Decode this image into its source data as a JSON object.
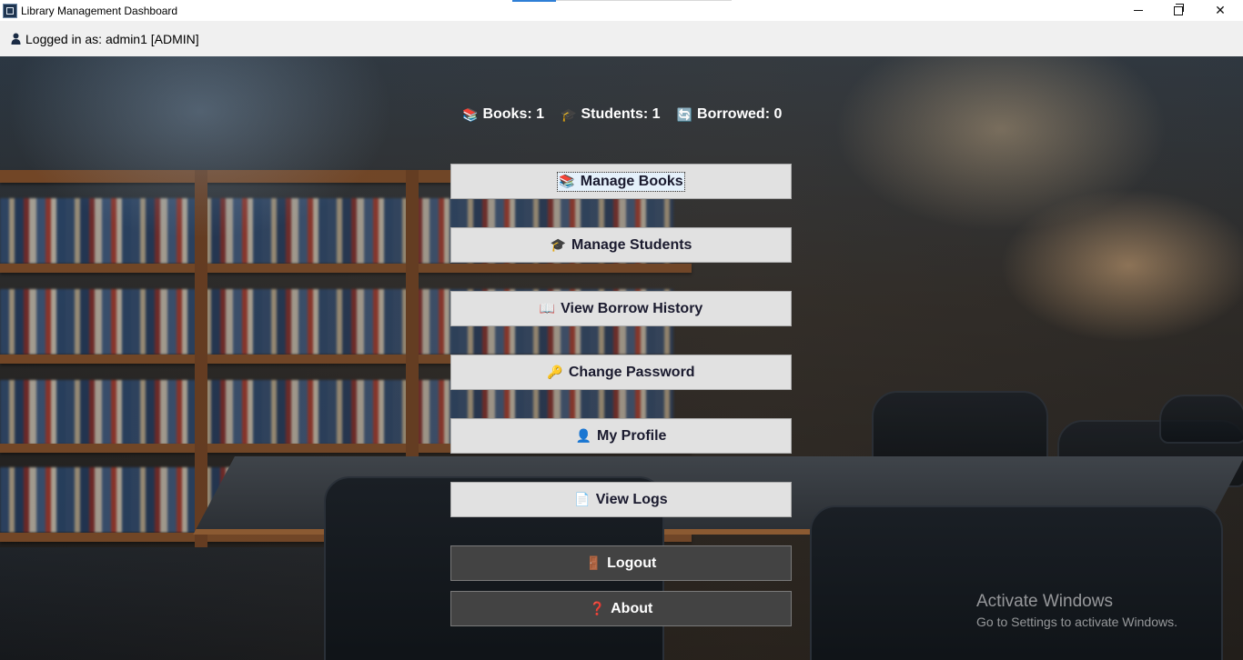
{
  "window": {
    "title": "Library Management Dashboard",
    "controls": {
      "minimize": "minimize",
      "maximize": "restore",
      "close": "✕"
    }
  },
  "status": {
    "user_icon": "user-icon",
    "text": "Logged in as: admin1 [ADMIN]"
  },
  "stats": [
    {
      "icon": "books-icon",
      "glyph": "📚",
      "label": "Books: 1"
    },
    {
      "icon": "graduation-cap-icon",
      "glyph": "🎓",
      "label": "Students: 1"
    },
    {
      "icon": "sync-icon",
      "glyph": "🔄",
      "label": "Borrowed: 0"
    }
  ],
  "menu": {
    "manage_books": {
      "icon": "books-icon",
      "glyph": "📚",
      "label": "Manage Books",
      "focused": true
    },
    "manage_students": {
      "icon": "graduation-cap-icon",
      "glyph": "🎓",
      "label": "Manage Students"
    },
    "view_borrow_history": {
      "icon": "open-book-icon",
      "glyph": "📖",
      "label": "View Borrow History"
    },
    "change_password": {
      "icon": "key-icon",
      "glyph": "🔑",
      "label": "Change Password"
    },
    "my_profile": {
      "icon": "user-icon",
      "glyph": "👤",
      "label": "My Profile"
    },
    "view_logs": {
      "icon": "document-icon",
      "glyph": "📄",
      "label": "View Logs"
    },
    "logout": {
      "icon": "door-icon",
      "glyph": "🚪",
      "label": "Logout"
    },
    "about": {
      "icon": "question-icon",
      "glyph": "❓",
      "label": "About"
    }
  },
  "watermark": {
    "title": "Activate Windows",
    "subtitle": "Go to Settings to activate Windows."
  },
  "colors": {
    "button_light": "#e1e1e1",
    "button_dark": "#434343",
    "button_text": "#1a1a2e",
    "stats_text": "#ffffff"
  }
}
